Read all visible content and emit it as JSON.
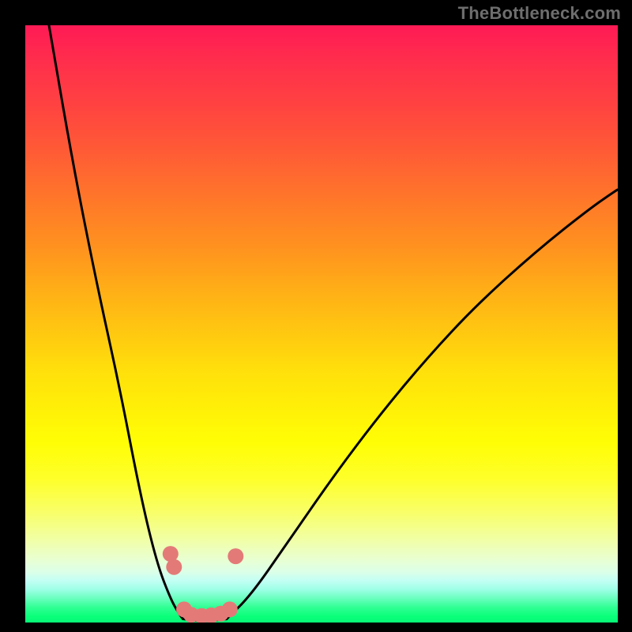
{
  "watermark": {
    "text": "TheBottleneck.com"
  },
  "chart_data": {
    "type": "line",
    "title": "",
    "xlabel": "",
    "ylabel": "",
    "x_range_fraction": [
      0,
      1
    ],
    "y_range_fraction_from_top": [
      0,
      1
    ],
    "gradient_meaning": "red (top) = high bottleneck, green (bottom) = low bottleneck",
    "series": [
      {
        "name": "left-branch",
        "x_frac": [
          0.04,
          0.08,
          0.12,
          0.16,
          0.195,
          0.222,
          0.245,
          0.259,
          0.266
        ],
        "y_frac_from_top": [
          0.0,
          0.23,
          0.43,
          0.61,
          0.79,
          0.9,
          0.96,
          0.985,
          0.994
        ]
      },
      {
        "name": "valley-floor",
        "x_frac": [
          0.266,
          0.3,
          0.34
        ],
        "y_frac_from_top": [
          0.994,
          0.998,
          0.994
        ]
      },
      {
        "name": "right-branch",
        "x_frac": [
          0.34,
          0.38,
          0.44,
          0.52,
          0.6,
          0.68,
          0.76,
          0.86,
          0.955,
          1.0
        ],
        "y_frac_from_top": [
          0.994,
          0.955,
          0.87,
          0.755,
          0.65,
          0.555,
          0.47,
          0.38,
          0.305,
          0.275
        ]
      }
    ],
    "markers": {
      "name": "highlighted-points",
      "color": "#e37a78",
      "radius_px": 10,
      "points": [
        {
          "x_frac": 0.245,
          "y_frac_from_top": 0.885
        },
        {
          "x_frac": 0.251,
          "y_frac_from_top": 0.907
        },
        {
          "x_frac": 0.268,
          "y_frac_from_top": 0.978
        },
        {
          "x_frac": 0.28,
          "y_frac_from_top": 0.987
        },
        {
          "x_frac": 0.298,
          "y_frac_from_top": 0.989
        },
        {
          "x_frac": 0.314,
          "y_frac_from_top": 0.988
        },
        {
          "x_frac": 0.33,
          "y_frac_from_top": 0.985
        },
        {
          "x_frac": 0.345,
          "y_frac_from_top": 0.978
        },
        {
          "x_frac": 0.355,
          "y_frac_from_top": 0.889
        }
      ]
    }
  }
}
